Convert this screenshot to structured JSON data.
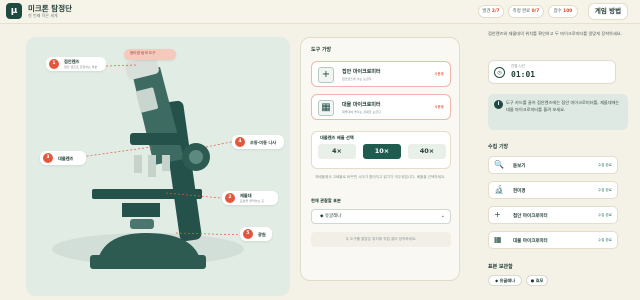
{
  "header": {
    "logo_glyph": "μ",
    "title": "미크론 탐정단",
    "subtitle": "첫 번째 작은 세계",
    "stats": [
      {
        "label": "발견",
        "value": "2/7"
      },
      {
        "label": "측정 완료",
        "value": "0/7"
      },
      {
        "label": "점수",
        "value": "100"
      }
    ],
    "how_to_play": "게임 방법"
  },
  "stage": {
    "callouts": [
      {
        "num": "1",
        "label": "접안렌즈",
        "desc": "접안 렌즈로 관찰하는 부분"
      },
      {
        "num": "2",
        "label": "재물대",
        "desc": "표본을 올려놓는 곳"
      },
      {
        "num": "3",
        "label": "대물렌즈",
        "desc": ""
      },
      {
        "num": "4",
        "label": "조동·미동 나사",
        "desc": ""
      },
      {
        "num": "5",
        "label": "광원",
        "desc": ""
      }
    ],
    "top_label": "현미경 탐색 도구"
  },
  "tools": {
    "title": "도구 가방",
    "items": [
      {
        "icon": "+",
        "name": "접안 마이크로미터",
        "desc": "접안렌즈에 넣는 눈금자",
        "tag": "사용중"
      },
      {
        "icon": "▦",
        "name": "대물 마이크로미터",
        "desc": "재물대에 올리는 정확한 눈금자",
        "tag": "사용중"
      }
    ],
    "zoom_title": "대물렌즈 배율 선택",
    "zooms": [
      "4×",
      "10×",
      "40×"
    ],
    "zoom_selected": "10×",
    "zoom_note": "저배율에서 고배율로 바꾸면 시야가 좁아지고 밝기가 어두워집니다. 배율을 선택하세요.",
    "current_sample_label": "현재 관찰할 표본",
    "current_sample": "◆ 유글레나",
    "hint": "두 도구를 알맞은 위치에 직접 끌어 장착하세요."
  },
  "side": {
    "intro": "접안렌즈와 재물대의 위치를 확인하고 두 마이크로미터를 알맞게 장착하세요.",
    "timer_label": "관찰 시간",
    "timer_value": "01:01",
    "info": "도구 카드를 끌어 접안렌즈에는 접안 마이크로미터를, 재물대에는 대물 마이크로미터를 올려 보세요.",
    "collect_title": "수집 기방",
    "collect": [
      {
        "icon": "🔍",
        "name": "돋보기",
        "tag": "수집 완료"
      },
      {
        "icon": "🔬",
        "name": "현미경",
        "tag": "수집 완료"
      },
      {
        "icon": "+",
        "name": "접안 마이크로미터",
        "tag": "수집 완료"
      },
      {
        "icon": "▦",
        "name": "대물 마이크로미터",
        "tag": "수집 완료"
      }
    ],
    "specimen_title": "표본 보관함",
    "specimens": [
      "◆ 유글레나",
      "● 효모"
    ]
  },
  "colors": {
    "accent": "#1f5c4f",
    "alert": "#e2573d"
  }
}
